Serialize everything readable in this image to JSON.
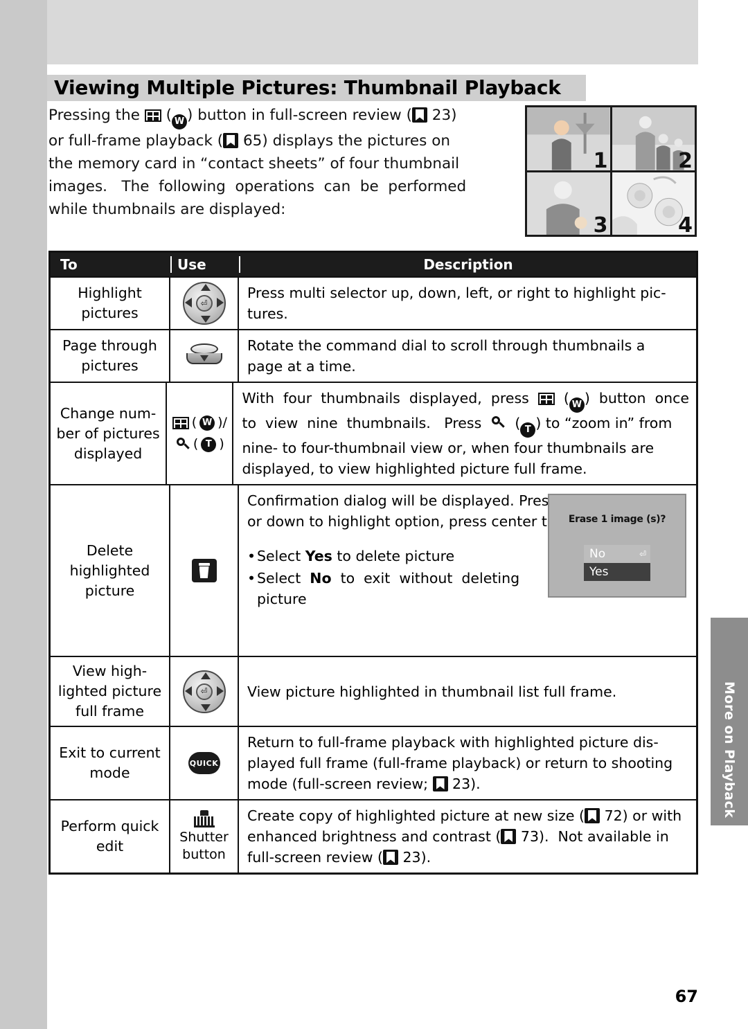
{
  "page": {
    "number": "67",
    "side_tab": "More on Playback",
    "title": "Viewing Multiple Pictures: Thumbnail Playback"
  },
  "intro": {
    "lines": [
      "Pressing the [thumb] ([W]) button in full-screen review ([bm] 23)",
      "or full-frame playback ([bm] 65)  displays the pictures on",
      "the memory card in “contact sheets” of four thumbnail",
      "images.   The following operations can be performed",
      "while thumbnails are displayed:"
    ]
  },
  "thumbnail_sample": {
    "numbers": [
      "1",
      "2",
      "3",
      "4"
    ]
  },
  "table": {
    "headers": {
      "to": "To",
      "use": "Use",
      "description": "Description"
    },
    "rows": [
      {
        "to": "Highlight\npictures",
        "use_icon": "multi-selector",
        "use_text": "",
        "description_lines": [
          "Press multi selector up, down, left, or right to highlight pic-",
          "tures."
        ]
      },
      {
        "to": "Page through\npictures",
        "use_icon": "command-dial",
        "use_text": "",
        "description_lines": [
          "Rotate  the  command  dial  to  scroll  through  thumbnails  a",
          "page at a time."
        ]
      },
      {
        "to": "Change num-\nber of pictures\ndisplayed",
        "use_icon": "zoom-buttons",
        "use_text": "",
        "description_lines": [
          "With  four  thumbnails  displayed,  press  [thumb]  ([W])  button  once",
          "to  view  nine  thumbnails.   Press  [magn] ([T]) to “zoom in” from",
          "nine- to four-thumbnail view or, when four thumbnails are",
          "displayed, to view highlighted picture full frame."
        ]
      },
      {
        "to": "Delete\nhighlighted\npicture",
        "use_icon": "trash",
        "use_text": "",
        "description_lines": [
          "Confirmation dialog will be displayed.  Press multi selector up",
          "or down to highlight option, press center to select."
        ],
        "bullets": [
          "Select Yes to delete picture",
          "Select  No  to  exit  without  deleting",
          "picture"
        ],
        "dialog": {
          "title": "Erase 1 image (s)?",
          "options": [
            "No",
            "Yes"
          ],
          "selected": "Yes"
        }
      },
      {
        "to": "View high-\nlighted picture\nfull frame",
        "use_icon": "multi-selector",
        "use_text": "",
        "description_lines": [
          "View picture highlighted in thumbnail list full frame."
        ]
      },
      {
        "to": "Exit to current\nmode",
        "use_icon": "quick-button",
        "use_text": "QUICK",
        "description_lines": [
          "Return  to  full-frame  playback  with  highlighted  picture  dis-",
          "played full frame (full-frame playback) or return to shooting",
          "mode (full-screen review; [bm] 23)."
        ]
      },
      {
        "to": "Perform quick\nedit",
        "use_icon": "shutter",
        "use_text": "Shutter\nbutton",
        "description_lines": [
          "Create copy of highlighted picture at new size ([bm] 72) or with",
          "enhanced brightness and contrast ([bm] 73).  Not available in",
          "full-screen review ([bm] 23)."
        ]
      }
    ]
  }
}
